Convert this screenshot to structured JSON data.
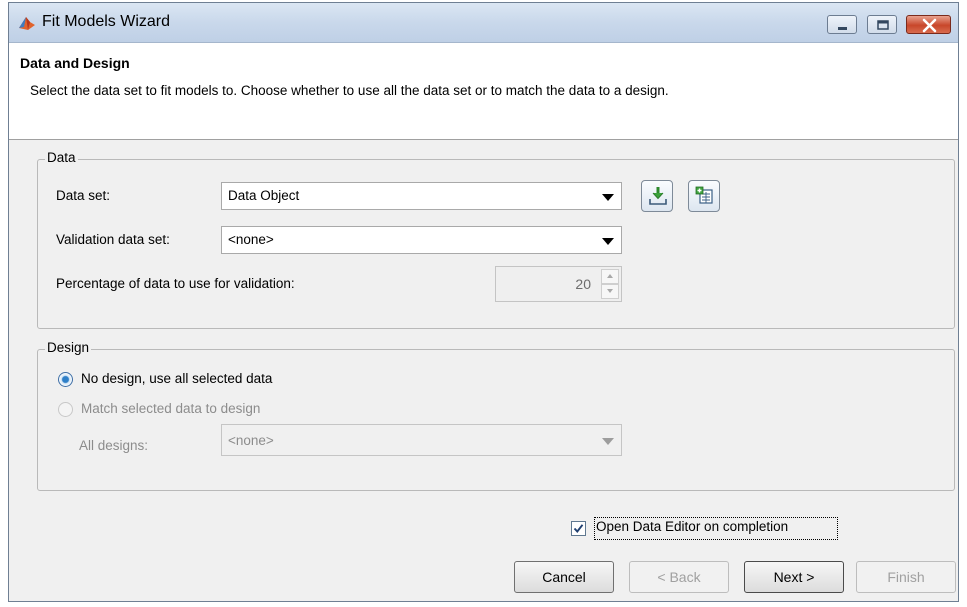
{
  "window": {
    "title": "Fit Models Wizard"
  },
  "header": {
    "title": "Data and Design",
    "description": "Select the data set to fit models to. Choose whether to use all the data set or to match the data to a design."
  },
  "data_group": {
    "legend": "Data",
    "data_set_label": "Data set:",
    "data_set_value": "Data Object",
    "validation_label": "Validation data set:",
    "validation_value": "<none>",
    "percentage_label": "Percentage of data to use for validation:",
    "percentage_value": "20",
    "import_icon": "import-data-icon",
    "new_data_icon": "new-data-icon"
  },
  "design_group": {
    "legend": "Design",
    "no_design_label": "No design, use all selected data",
    "match_design_label": "Match selected data to design",
    "all_designs_label": "All designs:",
    "all_designs_value": "<none>"
  },
  "footer": {
    "open_editor_label": "Open Data Editor on completion",
    "open_editor_checked": true,
    "cancel": "Cancel",
    "back": "< Back",
    "next": "Next >",
    "finish": "Finish"
  },
  "colors": {
    "window_bg": "#f0f0f0",
    "titlebar": "#c9d8eb",
    "close_button": "#c8472b"
  }
}
